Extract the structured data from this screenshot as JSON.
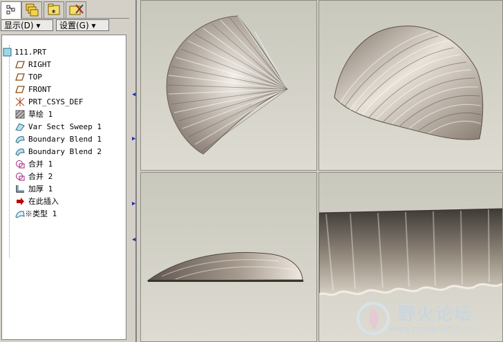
{
  "tabs": [
    {
      "icon": "model-tree-icon"
    },
    {
      "icon": "layers-icon"
    },
    {
      "icon": "folder-icon"
    },
    {
      "icon": "favorites-icon"
    }
  ],
  "toolbar": {
    "show_label": "显示(D) ▾",
    "settings_label": "设置(G) ▾"
  },
  "tree": {
    "items": [
      {
        "label": "111.PRT",
        "icon": "part-icon"
      },
      {
        "label": "RIGHT",
        "icon": "datum-plane-icon"
      },
      {
        "label": "TOP",
        "icon": "datum-plane-icon"
      },
      {
        "label": "FRONT",
        "icon": "datum-plane-icon"
      },
      {
        "label": "PRT_CSYS_DEF",
        "icon": "csys-icon"
      },
      {
        "label": "草绘 1",
        "icon": "sketch-icon"
      },
      {
        "label": "Var Sect Sweep 1",
        "icon": "sweep-icon"
      },
      {
        "label": "Boundary Blend 1",
        "icon": "boundary-blend-icon"
      },
      {
        "label": "Boundary Blend 2",
        "icon": "boundary-blend-icon"
      },
      {
        "label": "合并 1",
        "icon": "merge-icon"
      },
      {
        "label": "合并 2",
        "icon": "merge-icon"
      },
      {
        "label": "加厚 1",
        "icon": "thicken-icon"
      },
      {
        "label": "在此插入",
        "icon": "insert-here-arrow-icon"
      },
      {
        "label": "※类型 1",
        "icon": "style-icon"
      }
    ]
  },
  "viewports": [
    {
      "name": "shell-view-top"
    },
    {
      "name": "shell-view-isometric"
    },
    {
      "name": "shell-view-side"
    },
    {
      "name": "shell-view-edge-closeup"
    }
  ],
  "watermark": {
    "title": "野火论坛",
    "url": "www.proewildfire.cn"
  },
  "colors": {
    "panel_bg": "#d4d0c8",
    "viewport_bg": "#d6d4ca",
    "accent": "#2233aa"
  }
}
